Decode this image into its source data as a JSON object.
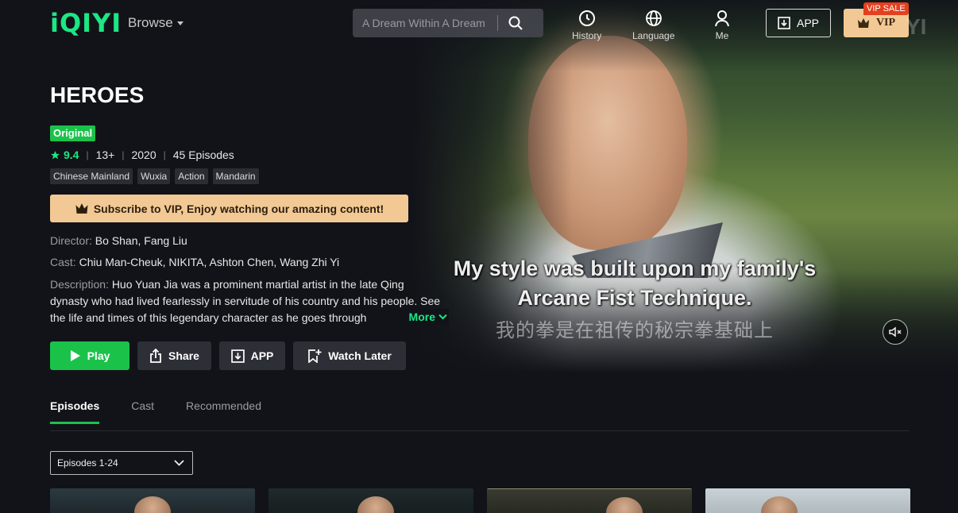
{
  "header": {
    "logo": "iQIYI",
    "browse_label": "Browse",
    "search_placeholder": "A Dream Within A Dream",
    "nav": [
      {
        "label": "History",
        "icon": "clock-icon"
      },
      {
        "label": "Language",
        "icon": "globe-icon"
      },
      {
        "label": "Me",
        "icon": "user-icon"
      }
    ],
    "app_label": "APP",
    "vip_label": "VIP",
    "vip_sale_badge": "VIP SALE",
    "ghost_logo": "YI"
  },
  "show": {
    "title": "HEROES",
    "badge": "Original",
    "rating": "9.4",
    "age": "13+",
    "year": "2020",
    "episodes": "45 Episodes",
    "tags": [
      "Chinese Mainland",
      "Wuxia",
      "Action",
      "Mandarin"
    ],
    "vip_banner": "Subscribe to VIP, Enjoy watching our amazing content!",
    "director_key": "Director:",
    "director": "Bo Shan, Fang Liu",
    "cast_key": "Cast:",
    "cast": "Chiu Man-Cheuk, NIKITA, Ashton Chen, Wang Zhi Yi",
    "description_key": "Description:",
    "description": "Huo Yuan Jia was a prominent martial artist in the late Qing dynasty who had lived fearlessly in servitude of his country and his people. See the life and times of this legendary character as he goes through",
    "more_label": "More"
  },
  "player": {
    "subtitle_line1": "My style was built upon my family's",
    "subtitle_line2": "Arcane Fist Technique.",
    "subtitle_cn": "我的拳是在祖传的秘宗拳基础上"
  },
  "actions": {
    "play": "Play",
    "share": "Share",
    "app": "APP",
    "watch_later": "Watch Later"
  },
  "tabs": [
    "Episodes",
    "Cast",
    "Recommended"
  ],
  "episode_range": "Episodes 1-24",
  "colors": {
    "accent_green": "#1bc24a",
    "vip_gold": "#f2c995",
    "sale_red": "#e3401f",
    "background": "#111319"
  }
}
